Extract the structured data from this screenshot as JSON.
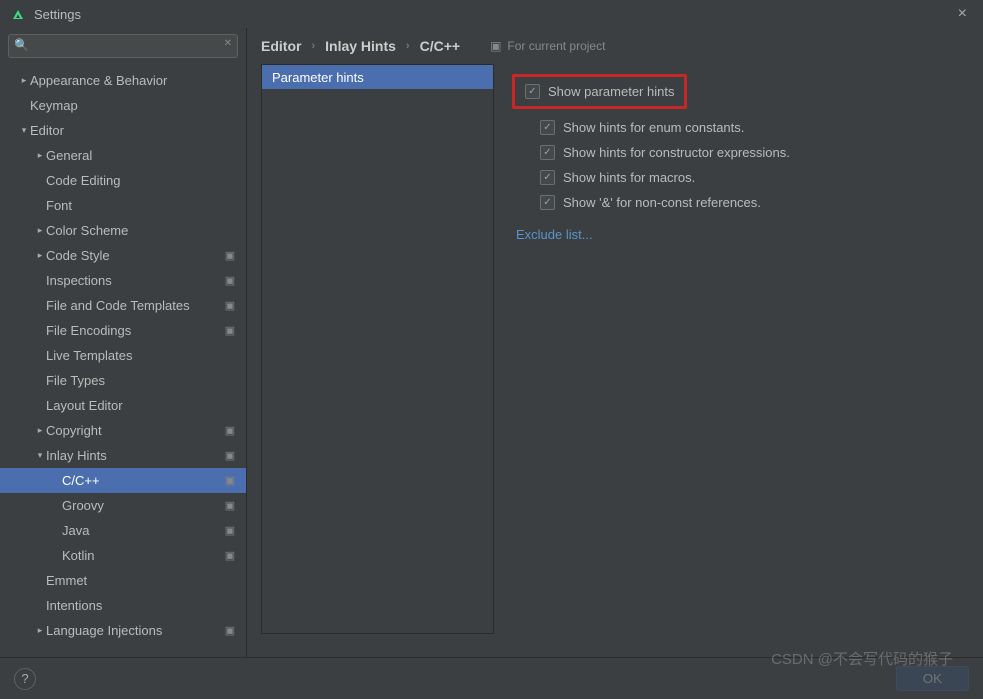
{
  "window": {
    "title": "Settings"
  },
  "search": {
    "placeholder": ""
  },
  "sidebar": {
    "items": [
      {
        "label": "Appearance & Behavior",
        "indent": 0,
        "arrow": "right"
      },
      {
        "label": "Keymap",
        "indent": 0,
        "arrow": "none"
      },
      {
        "label": "Editor",
        "indent": 0,
        "arrow": "down"
      },
      {
        "label": "General",
        "indent": 1,
        "arrow": "right"
      },
      {
        "label": "Code Editing",
        "indent": 1,
        "arrow": "none"
      },
      {
        "label": "Font",
        "indent": 1,
        "arrow": "none"
      },
      {
        "label": "Color Scheme",
        "indent": 1,
        "arrow": "right"
      },
      {
        "label": "Code Style",
        "indent": 1,
        "arrow": "right",
        "sheet": true
      },
      {
        "label": "Inspections",
        "indent": 1,
        "arrow": "none",
        "sheet": true
      },
      {
        "label": "File and Code Templates",
        "indent": 1,
        "arrow": "none",
        "sheet": true
      },
      {
        "label": "File Encodings",
        "indent": 1,
        "arrow": "none",
        "sheet": true
      },
      {
        "label": "Live Templates",
        "indent": 1,
        "arrow": "none"
      },
      {
        "label": "File Types",
        "indent": 1,
        "arrow": "none"
      },
      {
        "label": "Layout Editor",
        "indent": 1,
        "arrow": "none"
      },
      {
        "label": "Copyright",
        "indent": 1,
        "arrow": "right",
        "sheet": true
      },
      {
        "label": "Inlay Hints",
        "indent": 1,
        "arrow": "down",
        "sheet": true
      },
      {
        "label": "C/C++",
        "indent": 2,
        "arrow": "none",
        "sheet": true,
        "selected": true
      },
      {
        "label": "Groovy",
        "indent": 2,
        "arrow": "none",
        "sheet": true
      },
      {
        "label": "Java",
        "indent": 2,
        "arrow": "none",
        "sheet": true
      },
      {
        "label": "Kotlin",
        "indent": 2,
        "arrow": "none",
        "sheet": true
      },
      {
        "label": "Emmet",
        "indent": 1,
        "arrow": "none"
      },
      {
        "label": "Intentions",
        "indent": 1,
        "arrow": "none"
      },
      {
        "label": "Language Injections",
        "indent": 1,
        "arrow": "right",
        "sheet": true
      }
    ]
  },
  "breadcrumb": {
    "parts": [
      "Editor",
      "Inlay Hints",
      "C/C++"
    ],
    "scope": "For current project"
  },
  "list": {
    "items": [
      "Parameter hints"
    ]
  },
  "options": {
    "main": {
      "label": "Show parameter hints",
      "checked": true
    },
    "sub": [
      {
        "label": "Show hints for enum constants.",
        "checked": true
      },
      {
        "label": "Show hints for constructor expressions.",
        "checked": true
      },
      {
        "label": "Show hints for macros.",
        "checked": true
      },
      {
        "label": "Show '&' for non-const references.",
        "checked": true
      }
    ],
    "link": "Exclude list..."
  },
  "footer": {
    "ok": "OK"
  },
  "watermark": "CSDN @不会写代码的猴子"
}
